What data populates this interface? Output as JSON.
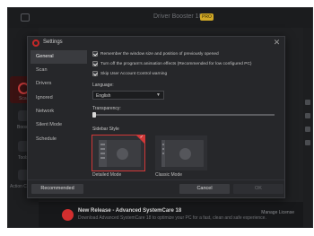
{
  "app": {
    "title": "Driver Booster 10",
    "badge": "PRO",
    "sidebar_labels": [
      "Scan",
      "Boost",
      "Tools",
      "Action Center"
    ],
    "promo": {
      "title": "New Release - Advanced SystemCare 18",
      "subtitle": "Download Advanced SystemCare 18 to optimize your PC for a fast, clean and safe experience.",
      "link": "Manage License"
    }
  },
  "dialog": {
    "title": "Settings",
    "nav": [
      "General",
      "Scan",
      "Drivers",
      "Ignored",
      "Network",
      "Silent Mode",
      "Schedule"
    ],
    "active_nav": "General",
    "options": [
      {
        "label": "Remember the window size and position of previously opened",
        "checked": true
      },
      {
        "label": "Turn off the program's animation effects (Recommended for low configured PC)",
        "checked": true
      },
      {
        "label": "Skip User Account Control warning",
        "checked": true
      }
    ],
    "language_label": "Language:",
    "language_value": "English",
    "transparency_label": "Transparency:",
    "transparency_value": 0,
    "sidebar_style_label": "Sidebar Style",
    "styles": [
      {
        "label": "Detailed Mode",
        "selected": true
      },
      {
        "label": "Classic Mode",
        "selected": false
      }
    ],
    "buttons": {
      "recommended": "Recommended",
      "cancel": "Cancel",
      "ok": "OK"
    }
  },
  "colors": {
    "accent": "#d13838",
    "dialog_bg": "#26272a",
    "nav_active": "#3a3b3f"
  }
}
